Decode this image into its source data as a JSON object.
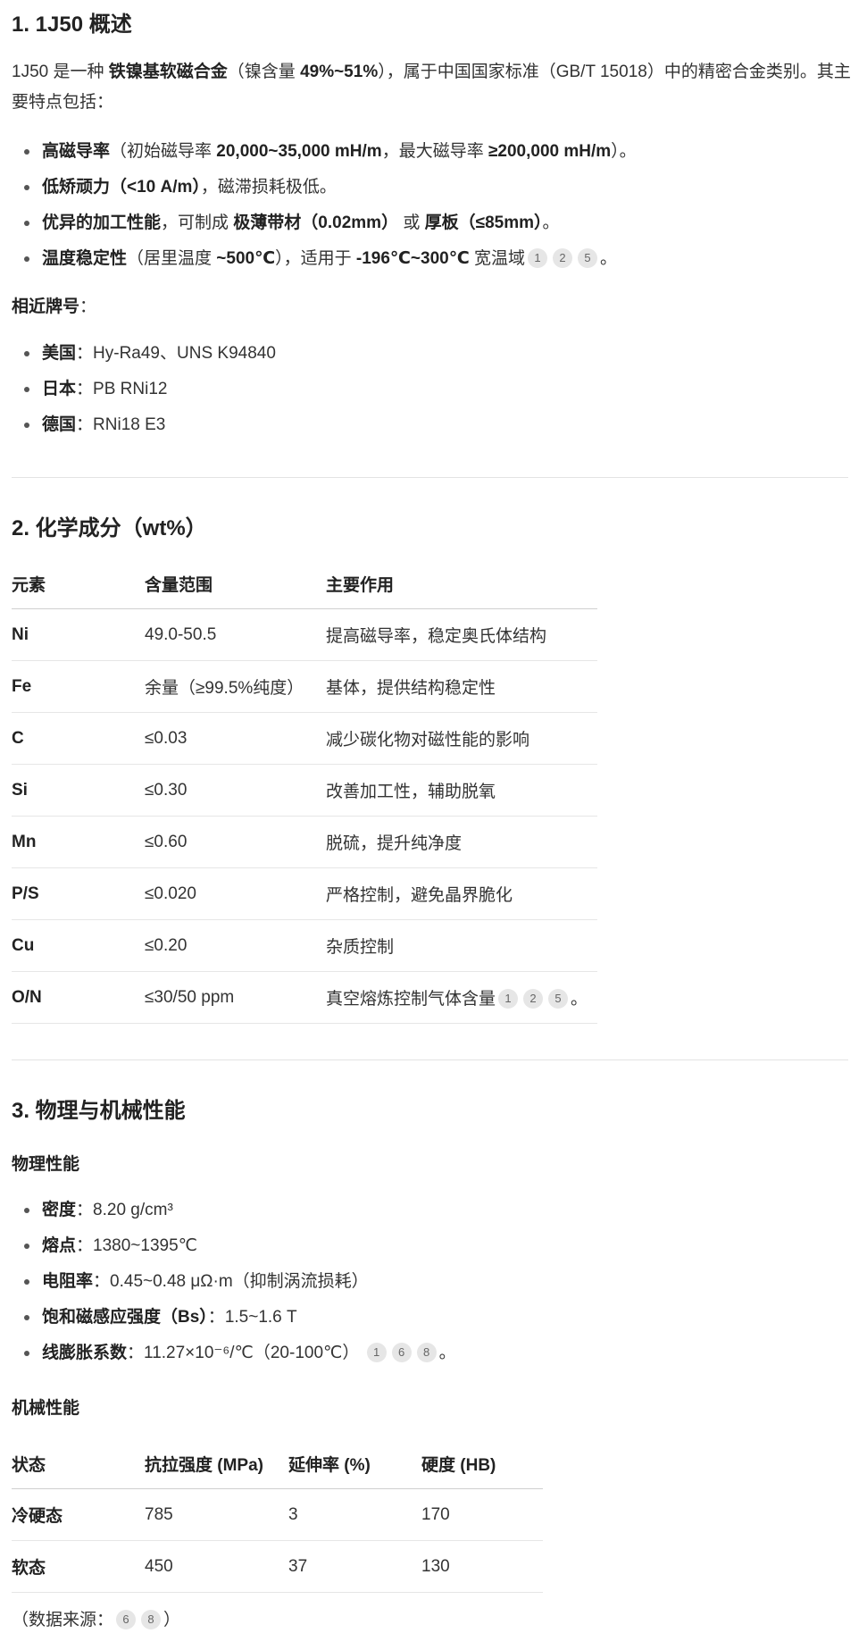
{
  "s1": {
    "title": "1. 1J50 概述",
    "intro": {
      "a": "1J50 是一种 ",
      "b1": "铁镍基软磁合金",
      "c": "（镍含量 ",
      "b2": "49%~51%",
      "d": "），属于中国国家标准（GB/T 15018）中的精密合金类别。其主要特点包括："
    },
    "features": [
      {
        "bold": "高磁导率",
        "rest_a": "（初始磁导率 ",
        "bold2": "20,000~35,000 mH/m",
        "rest_b": "，最大磁导率 ",
        "bold3": "≥200,000 mH/m",
        "rest_c": "）。"
      },
      {
        "bold": "低矫顽力",
        "bold2": "（<10 A/m）",
        "rest_a": "，磁滞损耗极低。"
      },
      {
        "bold": "优异的加工性能",
        "rest_a": "，可制成 ",
        "bold2": "极薄带材（0.02mm）",
        "rest_b": " 或 ",
        "bold3": "厚板（≤85mm）",
        "rest_c": "。"
      },
      {
        "bold": "温度稳定性",
        "rest_a": "（居里温度 ",
        "bold2": "~500℃",
        "rest_b": "），适用于 ",
        "bold3": "-196℃~300℃",
        "rest_c": " 宽温域",
        "cites": [
          "1",
          "2",
          "5"
        ],
        "end": "。"
      }
    ],
    "similar_label": "相近牌号",
    "similar_colon": "：",
    "similar": [
      {
        "country": "美国",
        "sep": "：",
        "grade": "Hy-Ra49、UNS K94840"
      },
      {
        "country": "日本",
        "sep": "：",
        "grade": "PB RNi12"
      },
      {
        "country": "德国",
        "sep": "：",
        "grade": "RNi18 E3"
      }
    ]
  },
  "s2": {
    "title": "2. 化学成分（wt%）",
    "headers": [
      "元素",
      "含量范围",
      "主要作用"
    ],
    "rows": [
      [
        "Ni",
        "49.0-50.5",
        "提高磁导率，稳定奥氏体结构"
      ],
      [
        "Fe",
        "余量（≥99.5%纯度）",
        "基体，提供结构稳定性"
      ],
      [
        "C",
        "≤0.03",
        "减少碳化物对磁性能的影响"
      ],
      [
        "Si",
        "≤0.30",
        "改善加工性，辅助脱氧"
      ],
      [
        "Mn",
        "≤0.60",
        "脱硫，提升纯净度"
      ],
      [
        "P/S",
        "≤0.020",
        "严格控制，避免晶界脆化"
      ],
      [
        "Cu",
        "≤0.20",
        "杂质控制"
      ],
      [
        "O/N",
        "≤30/50 ppm",
        "真空熔炼控制气体含量"
      ]
    ],
    "last_cites": [
      "1",
      "2",
      "5"
    ],
    "last_end": "。"
  },
  "s3": {
    "title": "3. 物理与机械性能",
    "phys_title": "物理性能",
    "phys": [
      {
        "label": "密度",
        "sep": "：",
        "value": "8.20 g/cm³"
      },
      {
        "label": "熔点",
        "sep": "：",
        "value": "1380~1395℃"
      },
      {
        "label": "电阻率",
        "sep": "：",
        "value": "0.45~0.48 μΩ·m（抑制涡流损耗）"
      },
      {
        "label": "饱和磁感应强度（Bs）",
        "sep": "：",
        "value": "1.5~1.6 T"
      },
      {
        "label": "线膨胀系数",
        "sep": "：",
        "value": "11.27×10⁻⁶/℃（20-100℃）"
      }
    ],
    "phys_cites": [
      "1",
      "6",
      "8"
    ],
    "phys_end": "。",
    "mech_title": "机械性能",
    "mech_headers": [
      "状态",
      "抗拉强度 (MPa)",
      "延伸率 (%)",
      "硬度 (HB)"
    ],
    "mech_rows": [
      [
        "冷硬态",
        "785",
        "3",
        "170"
      ],
      [
        "软态",
        "450",
        "37",
        "130"
      ]
    ],
    "source_a": "（数据来源：",
    "source_cites": [
      "6",
      "8"
    ],
    "source_b": "）"
  }
}
